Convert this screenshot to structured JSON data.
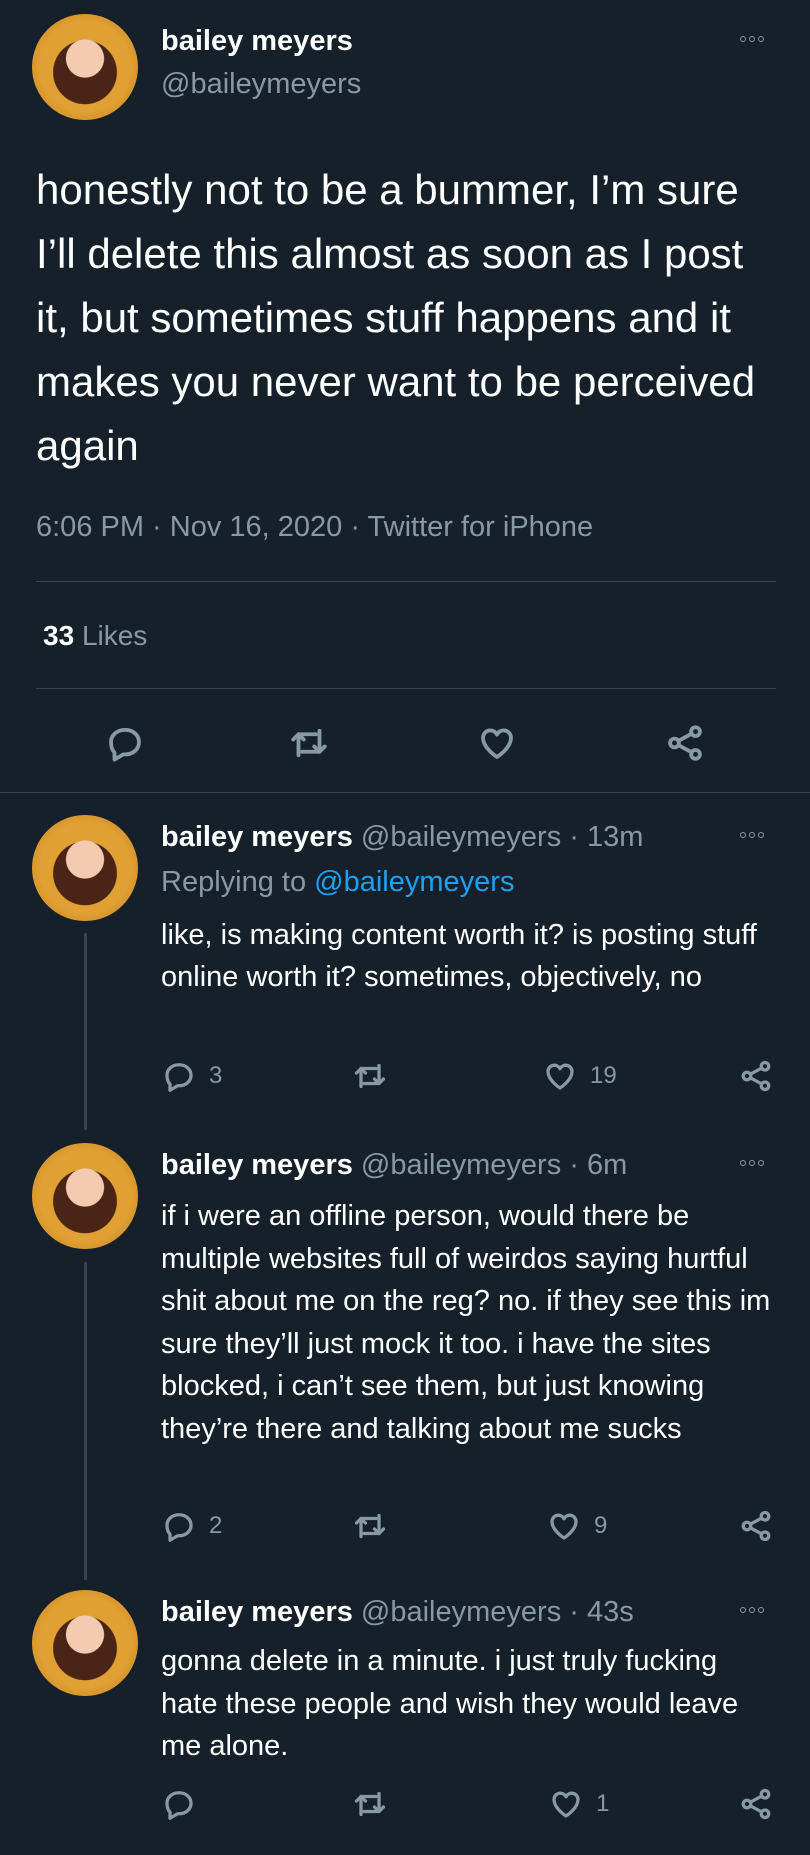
{
  "main_tweet": {
    "display_name": "bailey meyers",
    "handle": "@baileymeyers",
    "text": "honestly not to be a bummer, I’m sure I’ll delete this almost as soon as I post it, but sometimes stuff happens and it makes you never want to be perceived again",
    "timestamp": "6:06 PM · Nov 16, 2020 · Twitter for iPhone",
    "likes_count": "33",
    "likes_label": "Likes"
  },
  "replies": [
    {
      "display_name": "bailey meyers",
      "handle": "@baileymeyers",
      "time": "· 13m",
      "replying_label": "Replying to",
      "replying_handle": "@baileymeyers",
      "text": "like, is making content worth it? is posting stuff online worth it? sometimes, objectively, no",
      "reply_count": "3",
      "like_count": "19"
    },
    {
      "display_name": "bailey meyers",
      "handle": "@baileymeyers",
      "time": "· 6m",
      "text": "if i were an offline person, would there be multiple websites full of weirdos saying hurtful shit about me on the reg? no. if they see this im sure they’ll just mock it too. i have the sites blocked, i can’t see them, but just knowing they’re there and talking about me sucks",
      "reply_count": "2",
      "like_count": "9"
    },
    {
      "display_name": "bailey meyers",
      "handle": "@baileymeyers",
      "time": "· 43s",
      "text": "gonna delete in a minute. i just truly fucking hate these people and wish they would leave me alone.",
      "reply_count": "",
      "like_count": "1"
    }
  ],
  "icons": [
    "more-icon",
    "reply-icon",
    "retweet-icon",
    "like-icon",
    "share-icon"
  ],
  "colors": {
    "background": "#15202b",
    "muted": "#8899a6",
    "link": "#1da1f2",
    "divider": "#38444d"
  }
}
